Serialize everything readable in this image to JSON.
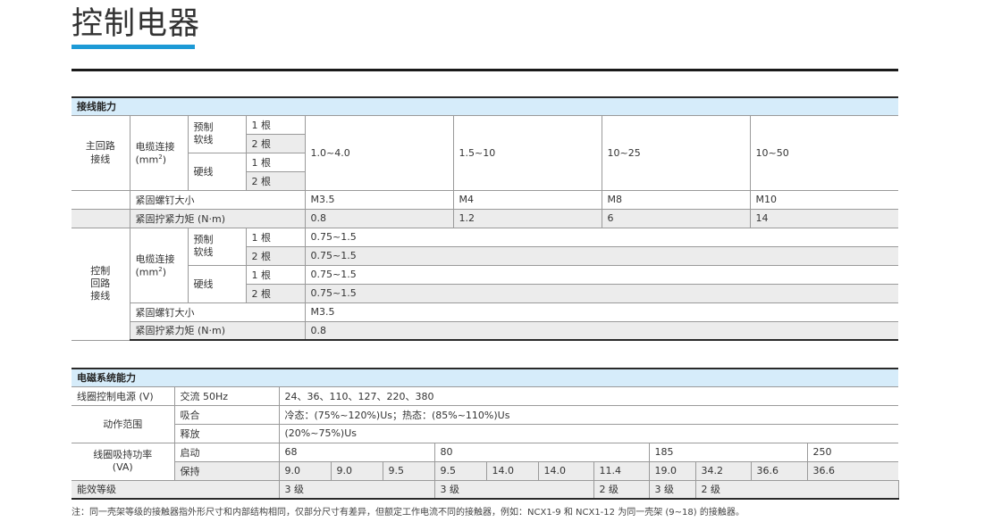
{
  "page": {
    "title": "控制电器"
  },
  "wiring": {
    "header": "接线能力",
    "main_circuit": "主回路\n接线",
    "control_circuit": "控制\n回路\n接线",
    "terminal_label": "电缆连接",
    "terminal_unit_prefix": "(mm",
    "terminal_unit_sup": "2",
    "terminal_unit_suffix": ")",
    "prefab_soft": "预制\n软线",
    "hard": "硬线",
    "one": "1 根",
    "two": "2 根",
    "main_values": [
      "1.0~4.0",
      "1.5~10",
      "10~25",
      "10~50"
    ],
    "screw_label": "紧固螺钉大小",
    "screw_values": [
      "M3.5",
      "M4",
      "M8",
      "M10"
    ],
    "torque_label": "紧固拧紧力矩 (N·m)",
    "torque_values": [
      "0.8",
      "1.2",
      "6",
      "14"
    ],
    "ctrl_values": [
      "0.75~1.5",
      "0.75~1.5",
      "0.75~1.5",
      "0.75~1.5"
    ],
    "ctrl_screw": "M3.5",
    "ctrl_torque": "0.8"
  },
  "electro": {
    "header": "电磁系统能力",
    "coil_supply_label": "线圈控制电源 (V)",
    "ac_label": "交流 50Hz",
    "ac_values": "24、36、110、127、220、380",
    "range_label": "动作范围",
    "pickup_label": "吸合",
    "pickup_value": "冷态：(75%~120%)Us；热态：(85%~110%)Us",
    "release_label": "释放",
    "release_value": "(20%~75%)Us",
    "power_label": "线圈吸持功率\n(VA)",
    "start_label": "启动",
    "start_values": [
      "68",
      "80",
      "185",
      "250"
    ],
    "hold_label": "保持",
    "hold_values": [
      "9.0",
      "9.0",
      "9.5",
      "9.5",
      "14.0",
      "14.0",
      "11.4",
      "19.0",
      "34.2",
      "36.6",
      "36.6"
    ],
    "efficiency_label": "能效等级",
    "efficiency_values": [
      "3 级",
      "3 级",
      "2 级",
      "3 级",
      "2 级",
      "2 级"
    ]
  },
  "footnote": "注：同一壳架等级的接触器指外形尺寸和内部结构相同，仅部分尺寸有差异，但额定工作电流不同的接触器，例如：NCX1-9 和 NCX1-12 为同一壳架 (9~18) 的接触器。"
}
